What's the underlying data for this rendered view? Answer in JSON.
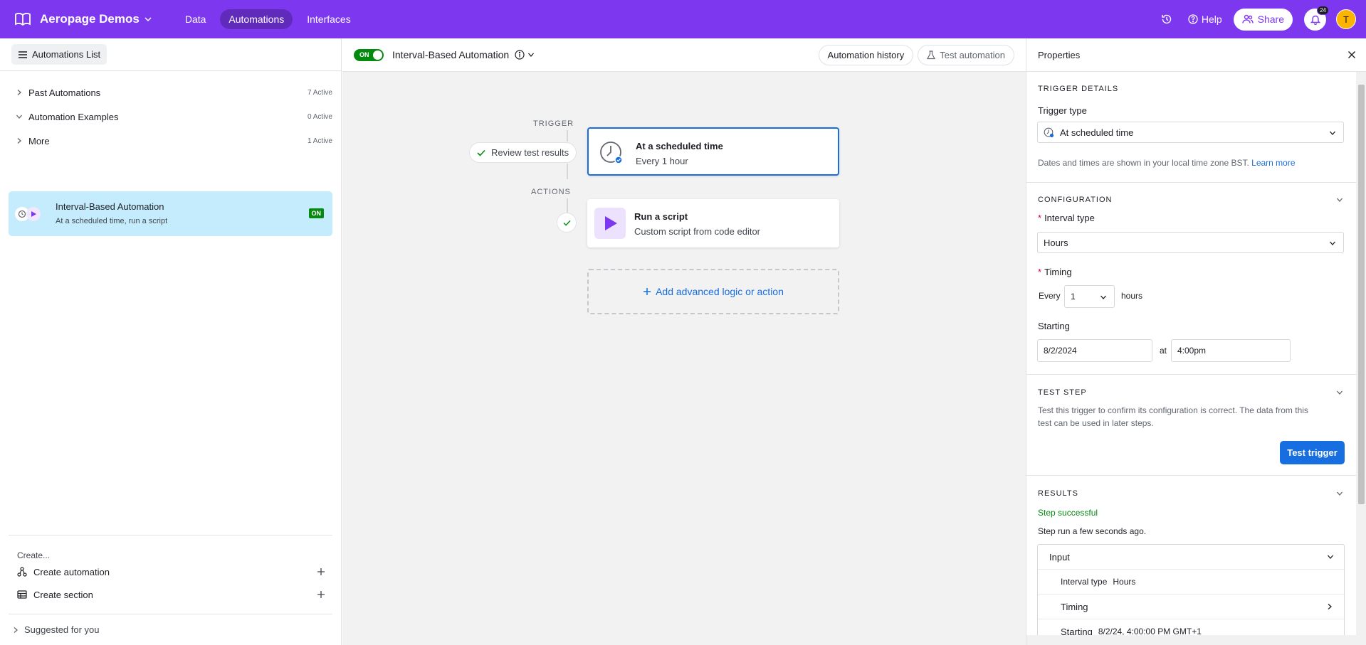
{
  "topbar": {
    "base_name": "Aeropage Demos",
    "tabs": [
      {
        "label": "Data"
      },
      {
        "label": "Automations"
      },
      {
        "label": "Interfaces"
      }
    ],
    "help_label": "Help",
    "share_label": "Share",
    "notification_count": "24",
    "avatar_initial": "T"
  },
  "sidebar": {
    "list_button": "Automations List",
    "sections": [
      {
        "label": "Past Automations",
        "count": "7 Active",
        "expanded": false
      },
      {
        "label": "Automation Examples",
        "count": "0 Active",
        "expanded": true
      },
      {
        "label": "More",
        "count": "1 Active",
        "expanded": false
      }
    ],
    "selected_automation": {
      "title": "Interval-Based Automation",
      "subtitle": "At a scheduled time, run a script",
      "status": "ON"
    },
    "create_label": "Create...",
    "create_automation": "Create automation",
    "create_section": "Create section",
    "suggested": "Suggested for you"
  },
  "canvas": {
    "toggle_label": "ON",
    "title": "Interval-Based Automation",
    "automation_history": "Automation history",
    "test_automation": "Test automation",
    "trigger_label": "TRIGGER",
    "actions_label": "ACTIONS",
    "review_results": "Review test results",
    "trigger_step": {
      "title": "At a scheduled time",
      "subtitle": "Every 1 hour"
    },
    "action_step": {
      "title": "Run a script",
      "subtitle": "Custom script from code editor"
    },
    "add_logic": "Add advanced logic or action"
  },
  "properties": {
    "title": "Properties",
    "trigger_details": "TRIGGER DETAILS",
    "trigger_type_label": "Trigger type",
    "trigger_type_value": "At scheduled time",
    "timezone_note": "Dates and times are shown in your local time zone BST.",
    "learn_more": "Learn more",
    "configuration": "CONFIGURATION",
    "interval_type_label": "Interval type",
    "interval_type_value": "Hours",
    "timing_label": "Timing",
    "every_label": "Every",
    "every_value": "1",
    "hours_label": "hours",
    "starting_label": "Starting",
    "start_date": "8/2/2024",
    "at_label": "at",
    "start_time": "4:00pm",
    "test_step": "TEST STEP",
    "test_step_desc_1": "Test this trigger to confirm its configuration is correct. The data from this",
    "test_step_desc_2": "test can be used in later steps.",
    "test_trigger": "Test trigger",
    "results": "RESULTS",
    "step_successful": "Step successful",
    "step_run": "Step run a few seconds ago.",
    "input_label": "Input",
    "rows": [
      {
        "key": "Interval type",
        "value": "Hours"
      },
      {
        "key": "Timing",
        "value": ""
      },
      {
        "key": "Starting",
        "value": "8/2/24, 4:00:00 PM GMT+1"
      }
    ]
  },
  "colors": {
    "brand": "#7c37ef",
    "accent_blue": "#166ee1",
    "on_green": "#048a0e",
    "selected_card": "#c4ecfd"
  }
}
